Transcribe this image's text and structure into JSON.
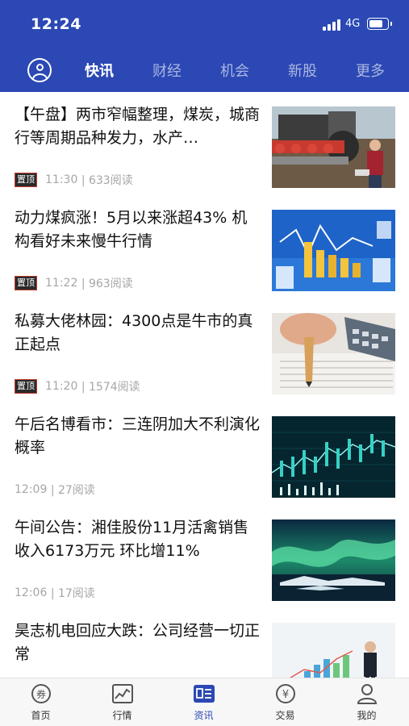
{
  "status_bar": {
    "time": "12:24",
    "network": "4G",
    "battery_level": 0.75
  },
  "tabs": [
    {
      "label": "快讯",
      "active": true
    },
    {
      "label": "财经",
      "active": false
    },
    {
      "label": "机会",
      "active": false
    },
    {
      "label": "新股",
      "active": false
    },
    {
      "label": "更多",
      "active": false
    }
  ],
  "articles": [
    {
      "title": "【午盘】两市窄幅整理，煤炭，城商行等周期品种发力，水产…",
      "badge": "置顶",
      "time": "11:30",
      "reads": "| 633阅读",
      "thumb": "tractor-field"
    },
    {
      "title": "动力煤疯涨！5月以来涨超43% 机构看好未来慢牛行情",
      "badge": "置顶",
      "time": "11:22",
      "reads": "| 963阅读",
      "thumb": "coin-chart"
    },
    {
      "title": "私募大佬林园：4300点是牛市的真正起点",
      "badge": "置顶",
      "time": "11:20",
      "reads": "| 1574阅读",
      "thumb": "pencil-calculator"
    },
    {
      "title": "午后名博看市：三连阴加大不利演化概率",
      "time": "12:09",
      "reads": "| 27阅读",
      "thumb": "candlestick-chart"
    },
    {
      "title": "午间公告：湘佳股份11月活禽销售收入6173万元 环比增11%",
      "time": "12:06",
      "reads": "| 17阅读",
      "thumb": "aurora"
    },
    {
      "title": "昊志机电回应大跌：公司经营一切正常",
      "time": "",
      "reads": "",
      "thumb": "businessman-chart"
    }
  ],
  "bottom_nav": [
    {
      "label": "首页",
      "icon": "coupon-icon",
      "active": false
    },
    {
      "label": "行情",
      "icon": "chart-icon",
      "active": false
    },
    {
      "label": "资讯",
      "icon": "news-icon",
      "active": true
    },
    {
      "label": "交易",
      "icon": "yuan-icon",
      "active": false
    },
    {
      "label": "我的",
      "icon": "profile-icon",
      "active": false
    }
  ],
  "colors": {
    "brand": "#2b48b4",
    "badge_border": "#c13a2d",
    "meta_text": "#a6a6a6"
  }
}
